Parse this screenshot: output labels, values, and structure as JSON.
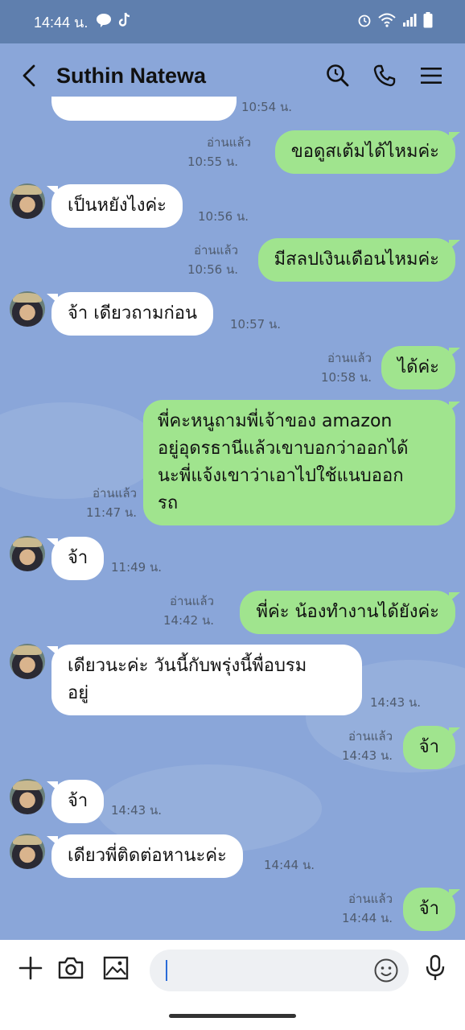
{
  "status_bar": {
    "time": "14:44 น.",
    "app_icons": [
      "line-icon",
      "tiktok-icon"
    ],
    "right_icons": [
      "alarm-icon",
      "wifi-icon",
      "signal-icon",
      "battery-icon"
    ]
  },
  "header": {
    "contact_name": "Suthin Natewa",
    "icons": [
      "back-icon",
      "search-icon",
      "phone-icon",
      "menu-icon"
    ]
  },
  "messages": {
    "partial_time": "10:54 น.",
    "m1": {
      "text": "ขอดูสเต้มได้ไหมค่ะ",
      "read": "อ่านแล้ว",
      "time": "10:55 น."
    },
    "m2": {
      "text": "เป็นหยังไงค่ะ",
      "time": "10:56 น."
    },
    "m3": {
      "text": "มีสลปเงินเดือนไหมค่ะ",
      "read": "อ่านแล้ว",
      "time": "10:56 น."
    },
    "m4": {
      "text": "จ้า เดียวถามก่อน",
      "time": "10:57 น."
    },
    "m5": {
      "text": "ได้ค่ะ",
      "read": "อ่านแล้ว",
      "time": "10:58 น."
    },
    "m6": {
      "line1": "พี่คะหนูถามพี่เจ้าของ amazon",
      "line2": "อยู่อุดรธานีแล้วเขาบอกว่าออกได้",
      "line3": "นะพี่แจ้งเขาว่าเอาไปใช้แนบออก",
      "line4": "รถ",
      "read": "อ่านแล้ว",
      "time": "11:47 น."
    },
    "m7": {
      "text": "จ้า",
      "time": "11:49 น."
    },
    "m8": {
      "text": "พี่ค่ะ น้องทำงานได้ยังค่ะ",
      "read": "อ่านแล้ว",
      "time": "14:42 น."
    },
    "m9": {
      "line1": "เดียวนะค่ะ วันนี้กับพรุ่งนี้พื่อบรม",
      "line2": "อยู่",
      "time": "14:43 น."
    },
    "m10": {
      "text": "จ้า",
      "read": "อ่านแล้ว",
      "time": "14:43 น."
    },
    "m11": {
      "text": "จ้า",
      "time": "14:43 น."
    },
    "m12": {
      "text": "เดียวพี่ติดต่อหานะค่ะ",
      "time": "14:44 น."
    },
    "m13": {
      "text": "จ้า",
      "read": "อ่านแล้ว",
      "time": "14:44 น."
    }
  },
  "composer": {
    "placeholder": "",
    "icons": [
      "plus-icon",
      "camera-icon",
      "image-icon",
      "emoji-icon",
      "microphone-icon"
    ]
  },
  "colors": {
    "chat_background": "#8aa6d9",
    "status_bar": "#5f7fae",
    "outgoing_bubble": "#a0e48e",
    "incoming_bubble": "#ffffff"
  }
}
